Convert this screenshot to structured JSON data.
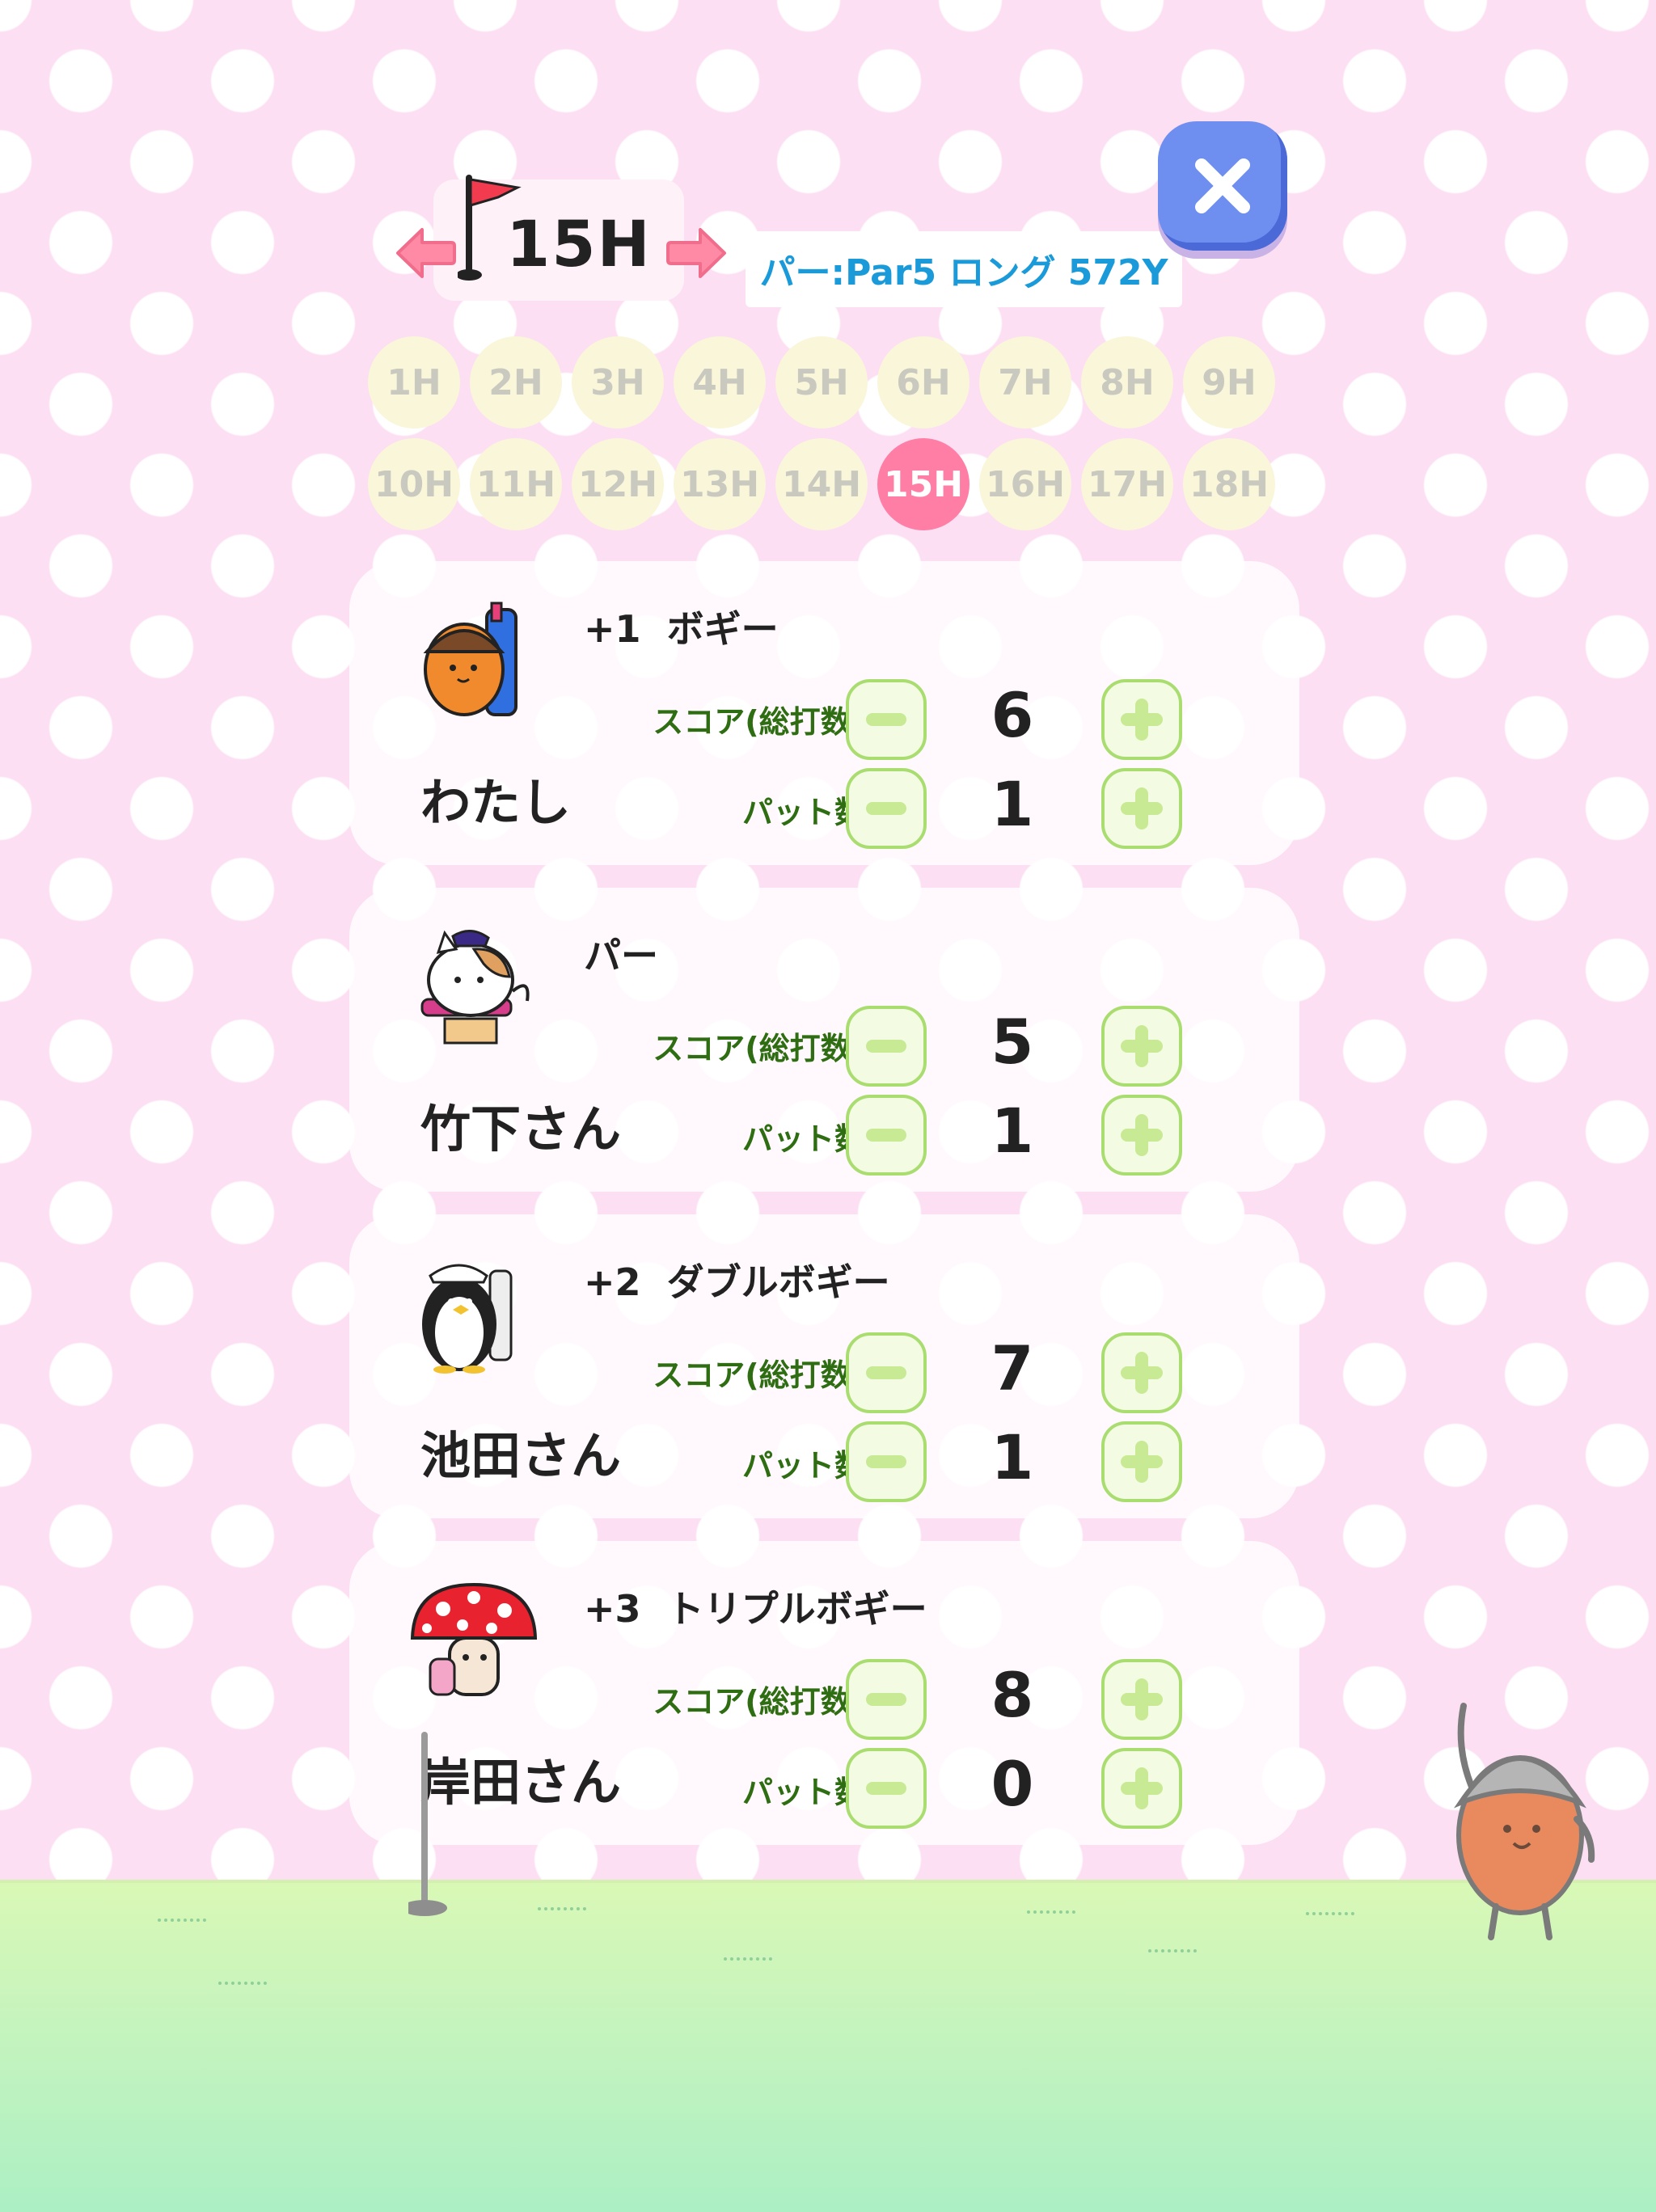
{
  "header": {
    "hole_title": "15H",
    "par_info": "パー:Par5 ロング 572Y",
    "prev_icon": "arrow-left-icon",
    "next_icon": "arrow-right-icon",
    "close_icon": "close-icon"
  },
  "holes": {
    "row1": [
      "1H",
      "2H",
      "3H",
      "4H",
      "5H",
      "6H",
      "7H",
      "8H",
      "9H"
    ],
    "row2": [
      "10H",
      "11H",
      "12H",
      "13H",
      "14H",
      "15H",
      "16H",
      "17H",
      "18H"
    ],
    "selected": "15H"
  },
  "labels": {
    "score": "スコア(総打数)",
    "putts": "パット数"
  },
  "players": [
    {
      "name": "わたし",
      "result": "+1  ボギー",
      "score": "6",
      "putts": "1",
      "avatar": "nut-caddie-avatar"
    },
    {
      "name": "竹下さん",
      "result": "パー",
      "score": "5",
      "putts": "1",
      "avatar": "cat-golfer-avatar"
    },
    {
      "name": "池田さん",
      "result": "+2  ダブルボギー",
      "score": "7",
      "putts": "1",
      "avatar": "penguin-golfer-avatar"
    },
    {
      "name": "岸田さん",
      "result": "+3  トリプルボギー",
      "score": "8",
      "putts": "0",
      "avatar": "mushroom-golfer-avatar"
    }
  ],
  "colors": {
    "background": "#fcdff2",
    "selected_hole": "#ff7ea6",
    "par_text": "#1a9ad9",
    "label_text": "#2e6d12",
    "close_button": "#6f8ff0",
    "stepper_border": "#a9dd70"
  }
}
